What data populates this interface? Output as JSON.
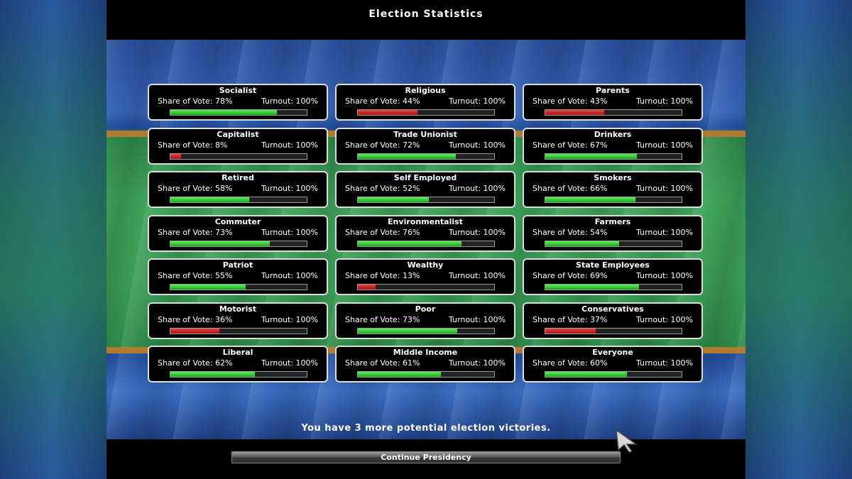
{
  "title": "Election Statistics",
  "share_label": "Share of Vote:",
  "turnout_label": "Turnout:",
  "groups": [
    {
      "name": "Socialist",
      "share": "78%",
      "turnout": "100%",
      "value": 78,
      "color": "green"
    },
    {
      "name": "Religious",
      "share": "44%",
      "turnout": "100%",
      "value": 44,
      "color": "red"
    },
    {
      "name": "Parents",
      "share": "43%",
      "turnout": "100%",
      "value": 43,
      "color": "red"
    },
    {
      "name": "Capitalist",
      "share": "8%",
      "turnout": "100%",
      "value": 8,
      "color": "red"
    },
    {
      "name": "Trade Unionist",
      "share": "72%",
      "turnout": "100%",
      "value": 72,
      "color": "green"
    },
    {
      "name": "Drinkers",
      "share": "67%",
      "turnout": "100%",
      "value": 67,
      "color": "green"
    },
    {
      "name": "Retired",
      "share": "58%",
      "turnout": "100%",
      "value": 58,
      "color": "green"
    },
    {
      "name": "Self Employed",
      "share": "52%",
      "turnout": "100%",
      "value": 52,
      "color": "green"
    },
    {
      "name": "Smokers",
      "share": "66%",
      "turnout": "100%",
      "value": 66,
      "color": "green"
    },
    {
      "name": "Commuter",
      "share": "73%",
      "turnout": "100%",
      "value": 73,
      "color": "green"
    },
    {
      "name": "Environmentalist",
      "share": "76%",
      "turnout": "100%",
      "value": 76,
      "color": "green"
    },
    {
      "name": "Farmers",
      "share": "54%",
      "turnout": "100%",
      "value": 54,
      "color": "green"
    },
    {
      "name": "Patriot",
      "share": "55%",
      "turnout": "100%",
      "value": 55,
      "color": "green"
    },
    {
      "name": "Wealthy",
      "share": "13%",
      "turnout": "100%",
      "value": 13,
      "color": "red"
    },
    {
      "name": "State Employees",
      "share": "69%",
      "turnout": "100%",
      "value": 69,
      "color": "green"
    },
    {
      "name": "Motorist",
      "share": "36%",
      "turnout": "100%",
      "value": 36,
      "color": "red"
    },
    {
      "name": "Poor",
      "share": "73%",
      "turnout": "100%",
      "value": 73,
      "color": "green"
    },
    {
      "name": "Conservatives",
      "share": "37%",
      "turnout": "100%",
      "value": 37,
      "color": "red"
    },
    {
      "name": "Liberal",
      "share": "62%",
      "turnout": "100%",
      "value": 62,
      "color": "green"
    },
    {
      "name": "Middle Income",
      "share": "61%",
      "turnout": "100%",
      "value": 61,
      "color": "green"
    },
    {
      "name": "Everyone",
      "share": "60%",
      "turnout": "100%",
      "value": 60,
      "color": "green"
    }
  ],
  "message": "You have 3 more potential election victories.",
  "continue_label": "Continue Presidency",
  "colors": {
    "good": "#2fd42f",
    "bad": "#d42020",
    "frame": "#dcdcdc"
  }
}
